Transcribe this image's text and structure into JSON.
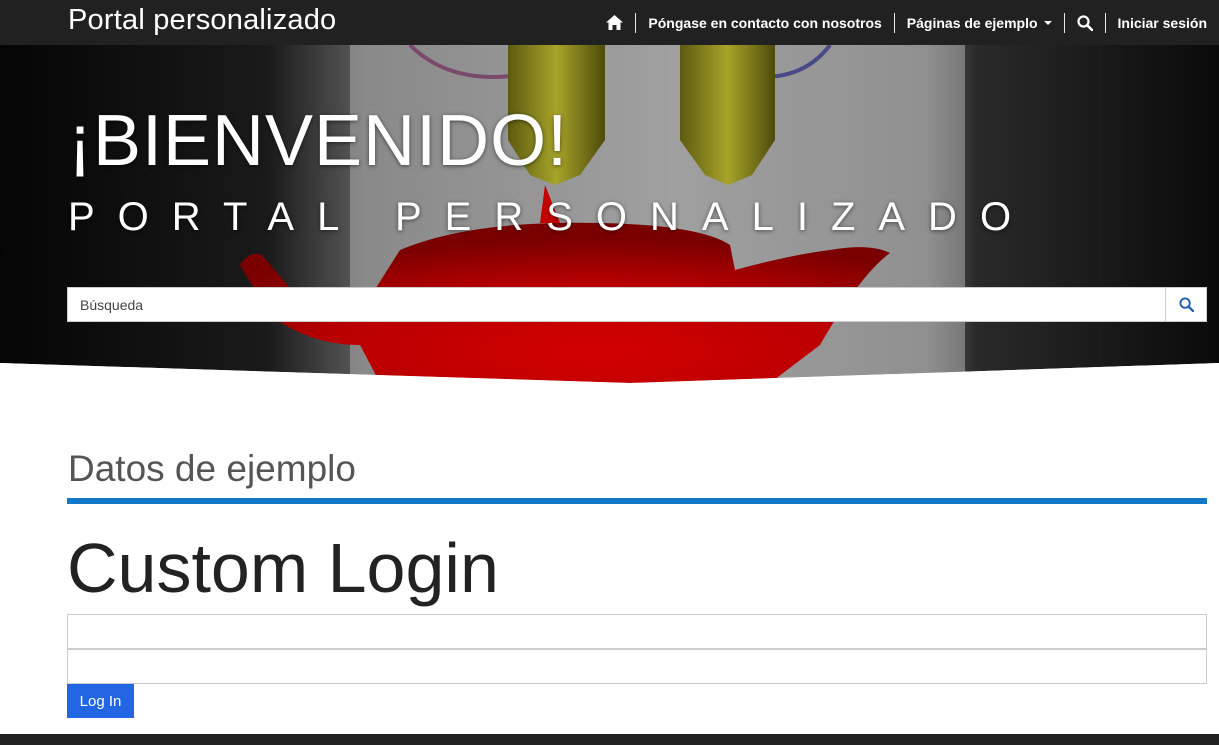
{
  "navbar": {
    "brand": "Portal personalizado",
    "home_icon": "home-icon",
    "contact": "Póngase en contacto con nosotros",
    "examples": "Páginas de ejemplo",
    "search_icon": "search-icon",
    "sign_in": "Iniciar sesión"
  },
  "hero": {
    "title": "¡BIENVENIDO!",
    "subtitle": "PORTAL PERSONALIZADO",
    "search_placeholder": "Búsqueda"
  },
  "content": {
    "section_heading": "Datos de ejemplo",
    "page_title": "Custom Login",
    "username_value": "",
    "password_value": "",
    "login_label": "Log In"
  },
  "colors": {
    "navbar_bg": "#212121",
    "accent_rule": "#1478c8",
    "button_bg": "#2266e3",
    "search_icon": "#1e5db3"
  }
}
